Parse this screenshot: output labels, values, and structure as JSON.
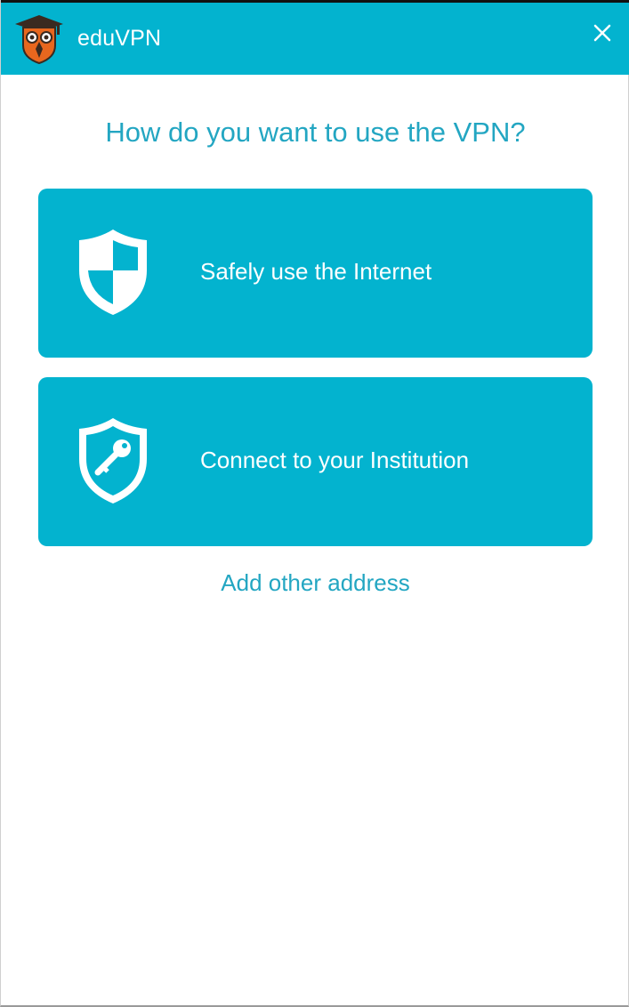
{
  "titlebar": {
    "app_name": "eduVPN",
    "logo_icon": "eduvpn-owl-shield-logo",
    "close_icon": "close-icon",
    "background": "#03b3cf"
  },
  "main": {
    "question": "How do you want to use the VPN?",
    "options": [
      {
        "label": "Safely use the Internet",
        "icon": "shield-checker-icon"
      },
      {
        "label": "Connect to your Institution",
        "icon": "shield-key-icon"
      }
    ],
    "add_other_label": "Add other address"
  },
  "colors": {
    "accent": "#03b3cf",
    "link_text": "#23a6c2",
    "logo_orange": "#e8671e",
    "logo_dark": "#3a2a20"
  }
}
